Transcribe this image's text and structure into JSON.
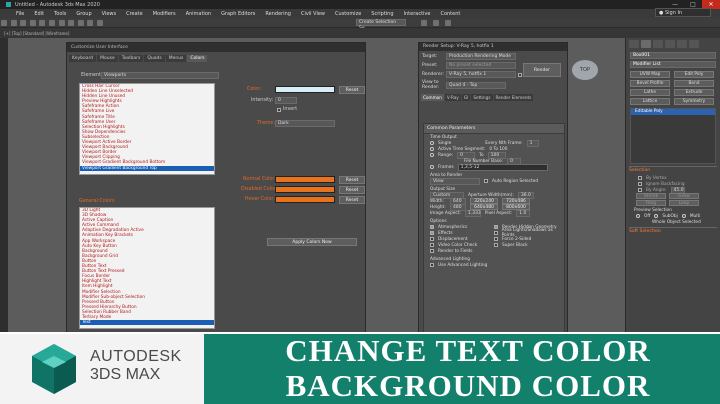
{
  "window": {
    "title": "Untitled - Autodesk 3ds Max 2020",
    "controls": [
      "—",
      "□",
      "✕"
    ],
    "sign_in": "Sign In"
  },
  "menubar": [
    "File",
    "Edit",
    "Tools",
    "Group",
    "Views",
    "Create",
    "Modifiers",
    "Animation",
    "Graph Editors",
    "Rendering",
    "Civil View",
    "Customize",
    "Scripting",
    "Interactive",
    "Content"
  ],
  "toolbar": {
    "selection_set": "Create Selection Se"
  },
  "viewport": {
    "label": "[+] [Top] [Standard] [Wireframe]",
    "navcube_label": "TOP"
  },
  "customize_dialog": {
    "title": "Customize User Interface",
    "tabs": [
      "Keyboard",
      "Mouse",
      "Toolbars",
      "Quads",
      "Menus",
      "Colors"
    ],
    "active_tab": "Colors",
    "elements_label": "Elements:",
    "elements_value": "Viewports",
    "elements_list": [
      "Cross Hair Cursor",
      "Hidden Line Unselected",
      "Hidden Line Unused",
      "Preview Highlights",
      "Safeframe Action",
      "Safeframe Live",
      "Safeframe Title",
      "Safeframe User",
      "Selection Highlights",
      "Show Dependencies",
      "Subselection",
      "Viewport Active Border",
      "Viewport Background",
      "Viewport Border",
      "Viewport Clipping",
      "Viewport Gradient Background Bottom",
      "Viewport Gradient Background Top"
    ],
    "color_label": "Color:",
    "intensity_label": "Intensity:",
    "intensity_value": "0",
    "invert_label": "Invert",
    "reset_label": "Reset",
    "theme_label": "Theme:",
    "theme_value": "Dark",
    "normal_color_label": "Normal Color:",
    "disabled_color_label": "Disabled Color:",
    "hover_color_label": "Hover Color:",
    "general_colors_label": "General Colors",
    "general_list": [
      "3D Light",
      "3D Shadow",
      "Active Caption",
      "Active Command",
      "Adaptive Degradation Active",
      "Animation Key Brackets",
      "App Workspace",
      "Auto Key Button",
      "Background",
      "Background Grid",
      "Button",
      "Button Text",
      "Button Text Pressed",
      "Focus Border",
      "Highlight Text",
      "Item Highlight",
      "Modifier Selection",
      "Modifier Sub-object Selection",
      "Pressed Button",
      "Pressed Hierarchy Button",
      "Selection Rubber Band",
      "Tertiary Mode",
      "Text"
    ],
    "apply_colors_label": "Apply Colors Now",
    "colors": {
      "swatch": "#e8731c",
      "color_swatch": "#d8eef7",
      "selected": "#1b5fb5",
      "list_text": "#b01818"
    }
  },
  "render_setup": {
    "title": "Render Setup: V-Ray 5, hotfix 1",
    "target_label": "Target:",
    "target_value": "Production Rendering Mode",
    "preset_label": "Preset:",
    "preset_value": "No preset selected",
    "renderer_label": "Renderer:",
    "renderer_value": "V-Ray 5, hotfix 1",
    "save_file_label": "Save File",
    "view_label": "View to Render:",
    "view_value": "Quad 4 - Top",
    "render_button": "Render",
    "tabs": [
      "Common",
      "V-Ray",
      "GI",
      "Settings",
      "Render Elements"
    ],
    "active_tab": "Common",
    "section_common": "Common Parameters",
    "time_output": "Time Output",
    "single": "Single",
    "every_nth": "Every Nth Frame:",
    "every_nth_value": "1",
    "active_segment": "Active Time Segment:",
    "active_segment_value": "0 To 100",
    "range": "Range:",
    "range_from": "0",
    "range_to_label": "To",
    "range_to": "100",
    "file_number_base": "File Number Base:",
    "file_number_base_value": "0",
    "frames_label": "Frames",
    "frames_value": "1,3,5-12",
    "area_to_render": "Area to Render",
    "area_value": "View",
    "auto_region": "Auto Region Selected",
    "output_size": "Output Size",
    "output_value": "Custom",
    "aperture_label": "Aperture Width(mm):",
    "aperture_value": "36.0",
    "width_label": "Width:",
    "width_value": "640",
    "height_label": "Height:",
    "height_value": "480",
    "presets": [
      "320x240",
      "720x486",
      "640x480",
      "800x600"
    ],
    "image_aspect_label": "Image Aspect:",
    "image_aspect_value": "1.333",
    "pixel_aspect_label": "Pixel Aspect:",
    "pixel_aspect_value": "1.0",
    "options_label": "Options",
    "options": [
      "Atmospherics",
      "Render Hidden Geometry",
      "Effects",
      "Area Lights/Shadows as Points",
      "Displacement",
      "Force 2-Sided",
      "Video Color Check",
      "Super Black",
      "Render to Fields"
    ],
    "advanced_lighting": "Advanced Lighting",
    "use_advanced": "Use Advanced Lighting"
  },
  "command_panel": {
    "object_name": "Box001",
    "modifier_list": "Modifier List",
    "buttons": [
      "UVW Map",
      "Edit Poly",
      "Bevel Profile",
      "Bend",
      "Lathe",
      "Extrude",
      "Lattice",
      "Symmetry"
    ],
    "stack_item": "Editable Poly",
    "selection_section": "Selection",
    "by_vertex": "By Vertex",
    "ignore_backfacing": "Ignore Backfacing",
    "by_angle": "By Angle:",
    "by_angle_value": "45.0",
    "shrink": "Shrink",
    "grow": "Grow",
    "ring": "Ring",
    "loop": "Loop",
    "preview_selection": "Preview Selection",
    "preview_off": "Off",
    "preview_subobj": "SubObj",
    "preview_multi": "Multi",
    "whole_object": "Whole Object Selected",
    "soft_selection": "Soft Selection"
  },
  "banner": {
    "brand": "AUTODESK",
    "product": "3DS MAX",
    "line1": "CHANGE TEXT COLOR",
    "line2": "BACKGROUND COLOR",
    "colors": {
      "band": "#13806c",
      "logo_bg": "#f3f3f3",
      "text": "#ffffff"
    }
  }
}
